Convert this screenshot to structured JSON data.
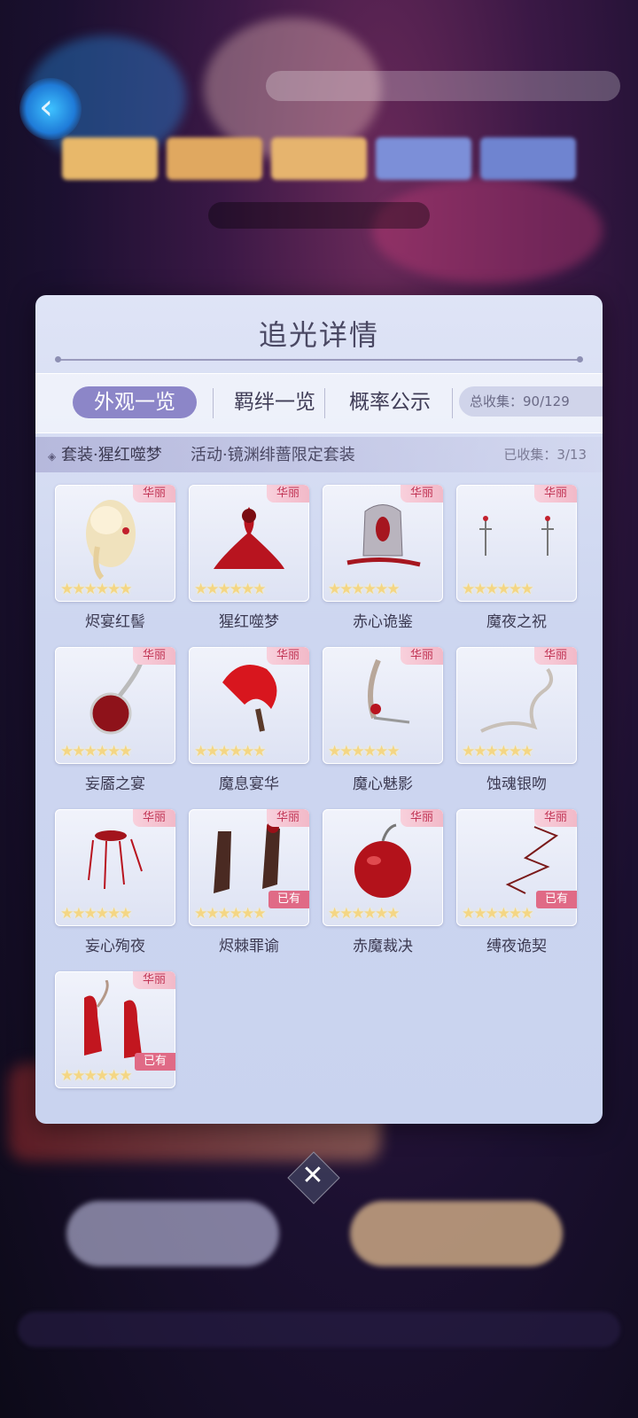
{
  "dialog": {
    "title": "追光详情",
    "tabs": [
      {
        "label": "外观一览"
      },
      {
        "label": "羁绊一览"
      },
      {
        "label": "概率公示"
      }
    ],
    "total_collected": "总收集：90/129",
    "set_name": "套装·猩红噬梦",
    "set_desc": "活动·镜渊绯蔷限定套装",
    "set_collected": "已收集：3/13"
  },
  "items": [
    {
      "name": "烬宴红髻",
      "tag": "华丽",
      "stars": "★★★★★★"
    },
    {
      "name": "猩红噬梦",
      "tag": "华丽",
      "stars": "★★★★★★"
    },
    {
      "name": "赤心诡鉴",
      "tag": "华丽",
      "stars": "★★★★★★"
    },
    {
      "name": "魔夜之祝",
      "tag": "华丽",
      "stars": "★★★★★★"
    },
    {
      "name": "妄靥之宴",
      "tag": "华丽",
      "stars": "★★★★★★"
    },
    {
      "name": "魔息宴华",
      "tag": "华丽",
      "stars": "★★★★★★"
    },
    {
      "name": "魔心魅影",
      "tag": "华丽",
      "stars": "★★★★★★"
    },
    {
      "name": "蚀魂银吻",
      "tag": "华丽",
      "stars": "★★★★★★"
    },
    {
      "name": "妄心殉夜",
      "tag": "华丽",
      "stars": "★★★★★★"
    },
    {
      "name": "烬棘罪谕",
      "tag": "华丽",
      "stars": "★★★★★★",
      "owned": "已有"
    },
    {
      "name": "赤魔裁决",
      "tag": "华丽",
      "stars": "★★★★★★"
    },
    {
      "name": "缚夜诡契",
      "tag": "华丽",
      "stars": "★★★★★★",
      "owned": "已有"
    },
    {
      "name": "",
      "tag": "华丽",
      "stars": "★★★★★★",
      "owned": "已有"
    }
  ],
  "close": {
    "glyph": "✕"
  },
  "icons": {
    "close": "close-icon",
    "back": "back-arrow-icon",
    "set": "diamond-icon"
  },
  "colors": {
    "accent": "#8c86c8",
    "tag_text": "#c23656",
    "owned_bg": "#e06a86",
    "star": "#f4d684"
  }
}
